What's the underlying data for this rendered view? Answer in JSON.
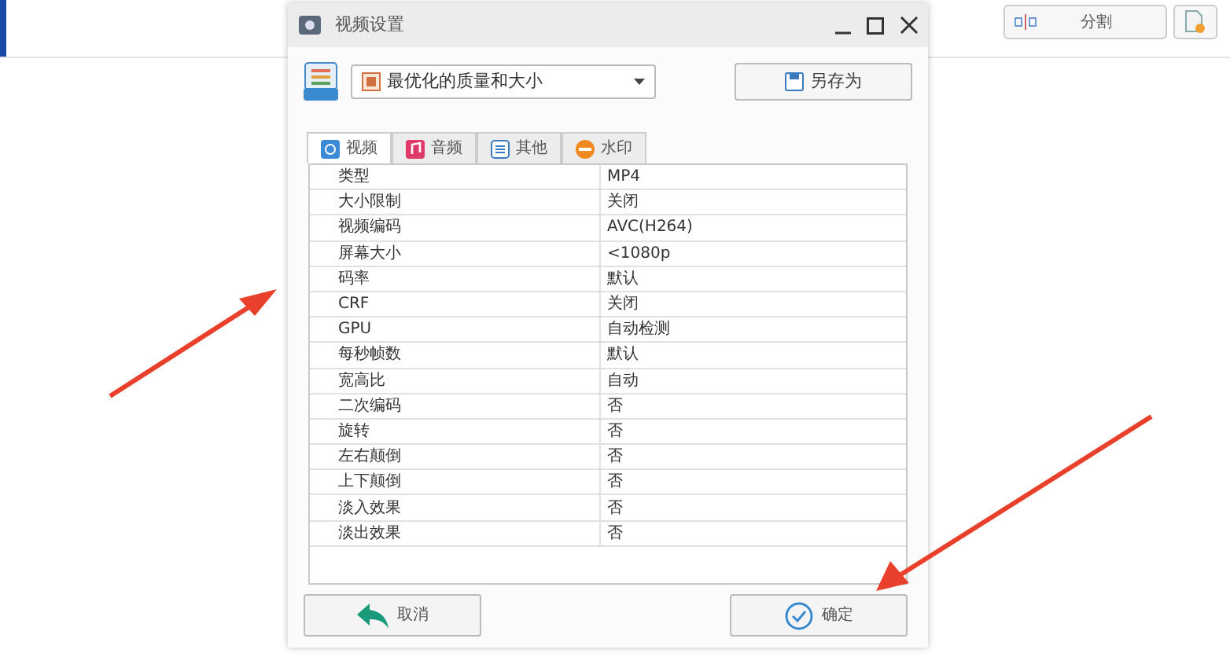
{
  "background": {
    "split_button": "分割"
  },
  "window": {
    "title": "视频设置"
  },
  "preset": {
    "value": "最优化的质量和大小"
  },
  "save_as_button": "另存为",
  "tabs": [
    {
      "label": "视频",
      "selected": true,
      "kind": "video"
    },
    {
      "label": "音频",
      "selected": false,
      "kind": "audio"
    },
    {
      "label": "其他",
      "selected": false,
      "kind": "other"
    },
    {
      "label": "水印",
      "selected": false,
      "kind": "watermark"
    }
  ],
  "table": {
    "rows": [
      [
        "类型",
        "MP4"
      ],
      [
        "大小限制",
        "关闭"
      ],
      [
        "视频编码",
        "AVC(H264)"
      ],
      [
        "屏幕大小",
        "<1080p"
      ],
      [
        "码率",
        "默认"
      ],
      [
        "CRF",
        "关闭"
      ],
      [
        "GPU",
        "自动检测"
      ],
      [
        "每秒帧数",
        "默认"
      ],
      [
        "宽高比",
        "自动"
      ],
      [
        "二次编码",
        "否"
      ],
      [
        "旋转",
        "否"
      ],
      [
        "左右颠倒",
        "否"
      ],
      [
        "上下颠倒",
        "否"
      ],
      [
        "淡入效果",
        "否"
      ],
      [
        "淡出效果",
        "否"
      ]
    ]
  },
  "buttons": {
    "cancel": "取消",
    "ok": "确定"
  }
}
